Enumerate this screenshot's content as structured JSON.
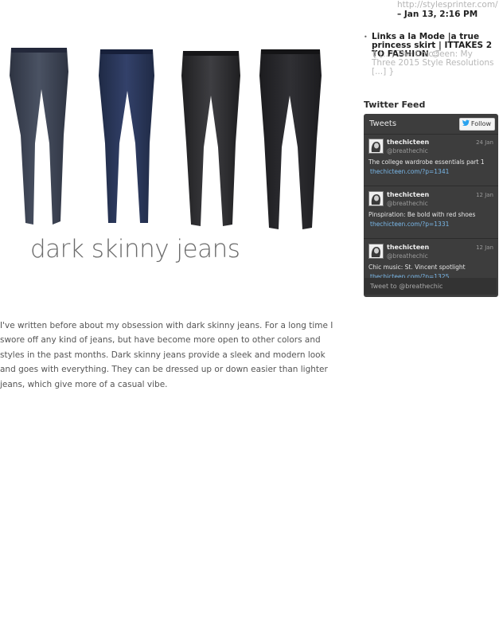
{
  "sidebar": {
    "recent_comments": {
      "first": {
        "url": "http://stylesprinter.com/ }",
        "date": "– Jan 13, 2:16 PM"
      },
      "second": {
        "title": "Links a la Mode |a true princess skirt | ITTAKES 2 TO FASHION",
        "gravatar_glyph": "☺",
        "excerpt": "{ [...] The Chic Teen: My Three 2015 Style Resolutions [...] }"
      }
    },
    "twitter": {
      "heading": "Twitter Feed",
      "tweets_label": "Tweets",
      "follow_label": "Follow",
      "tweets": [
        {
          "name": "thechicteen",
          "handle": "@breathechic",
          "time": "24 Jan",
          "text": "The college wardrobe essentials part 1",
          "link": "thechicteen.com/?p=1341"
        },
        {
          "name": "thechicteen",
          "handle": "@breathechic",
          "time": "12 Jan",
          "text": "Pinspiration: Be bold with red shoes",
          "link": "thechicteen.com/?p=1331"
        },
        {
          "name": "thechicteen",
          "handle": "@breathechic",
          "time": "12 Jan",
          "text": "Chic music: St. Vincent spotlight",
          "link": "thechicteen.com/?p=1325"
        }
      ],
      "compose_placeholder": "Tweet to @breathechic"
    }
  },
  "post": {
    "image_caption": "dark skinny jeans",
    "jeans_colors": [
      "#3a4050",
      "#28334f",
      "#2c2c2e",
      "#2a2a2d"
    ],
    "body": "I've written before about my obsession with dark skinny jeans. For a long time I swore off any kind of jeans, but have become more open to other colors and styles in the past months. Dark skinny jeans provide a sleek and modern look and goes with everything. They can be dressed up or down easier than lighter jeans, which give more of a casual vibe."
  },
  "icons": {
    "twitter_bird": "bird-icon",
    "gravatar": "gravatar-icon"
  },
  "colors": {
    "widget_bg": "#3d3d3d",
    "link_blue": "#79b7e8"
  }
}
